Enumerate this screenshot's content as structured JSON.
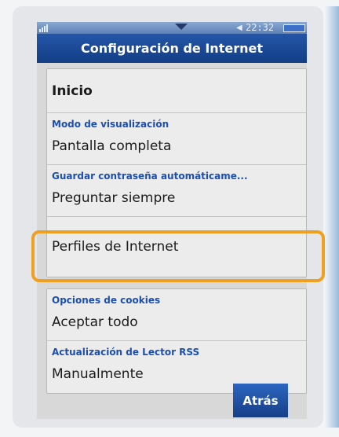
{
  "status_bar": {
    "time": "22:32",
    "signal_icon": "signal-bars-icon",
    "notification_icon": "down-arrow-icon",
    "speaker_icon": "speaker-icon",
    "battery_icon": "battery-icon"
  },
  "title": "Configuración de Internet",
  "menu": [
    {
      "label": "",
      "value": "Inicio"
    },
    {
      "label": "Modo de visualización",
      "value": "Pantalla completa"
    },
    {
      "label": "Guardar contraseña automáticame...",
      "value": "Preguntar siempre"
    },
    {
      "label": "",
      "value": "Perfiles de Internet"
    }
  ],
  "menu2": [
    {
      "label": "Opciones de cookies",
      "value": "Aceptar todo"
    },
    {
      "label": "Actualización de Lector RSS",
      "value": "Manualmente"
    }
  ],
  "softkey": {
    "back": "Atrás"
  },
  "colors": {
    "title_bar": "#1a4a9a",
    "label_blue": "#1d4fb0",
    "highlight_ring": "#f0a020",
    "background": "#e4e6e9"
  }
}
